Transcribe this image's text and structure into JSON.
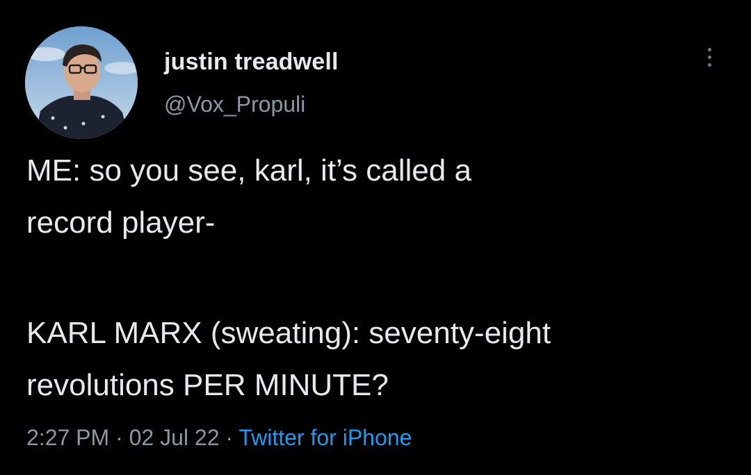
{
  "tweet": {
    "author": {
      "display_name": "justin treadwell",
      "handle": "@Vox_Propuli",
      "avatar_icon": "profile-photo"
    },
    "more_icon": "vertical-ellipsis-icon",
    "text_lines": [
      "ME: so you see, karl, it’s called a",
      "record player-",
      "KARL MARX (sweating): seventy-eight",
      "revolutions PER MINUTE?"
    ],
    "time": "2:27 PM",
    "separator": "·",
    "date": "02 Jul 22",
    "source": "Twitter for iPhone"
  },
  "colors": {
    "background": "#000000",
    "text": "#e7e9ea",
    "secondary_text": "#8b98a5",
    "link": "#1d9bf0"
  }
}
